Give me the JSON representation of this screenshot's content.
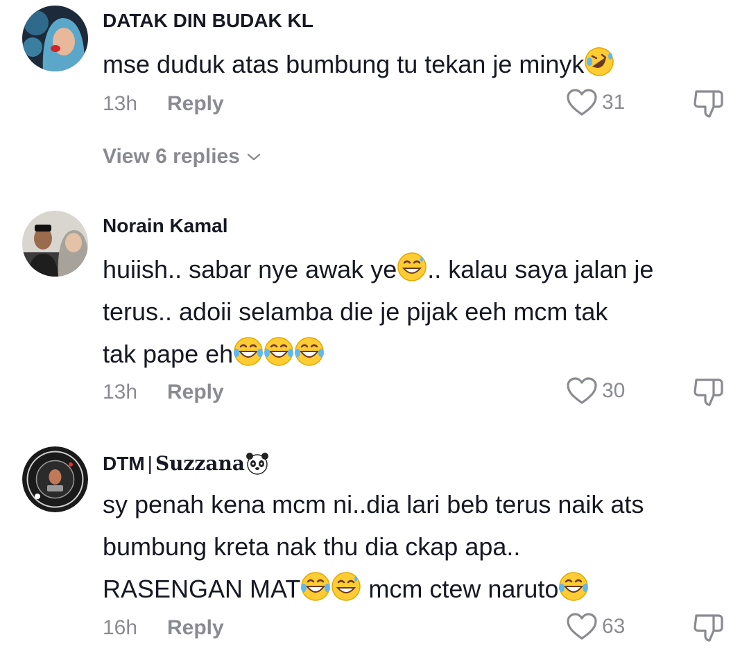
{
  "comments": [
    {
      "username": "DATAK DIN BUDAK KL",
      "lines": [
        {
          "text": "mse duduk atas bumbung tu tekan je minyk",
          "emojis": [
            "rofl"
          ]
        }
      ],
      "time": "13h",
      "reply_label": "Reply",
      "likes": "31",
      "view_replies": "View 6 replies"
    },
    {
      "username": "Norain Kamal",
      "lines": [
        {
          "text": "huiish.. sabar nye awak ye",
          "emojis": [
            "sweat-smile"
          ],
          "after": ".. kalau saya jalan je"
        },
        {
          "text": "terus.. adoii selamba die je pijak eeh mcm tak",
          "emojis": []
        },
        {
          "text": "tak pape eh",
          "emojis": [
            "tears-of-joy",
            "tears-of-joy",
            "tears-of-joy"
          ]
        }
      ],
      "time": "13h",
      "reply_label": "Reply",
      "likes": "30"
    },
    {
      "username_prefix": "DTM",
      "username_separator": "|",
      "username_styled": "Suzzana",
      "username_icon": "panda-icon",
      "lines": [
        {
          "text": "sy penah kena mcm ni..dia lari beb terus naik ats",
          "emojis": []
        },
        {
          "text": "bumbung kreta nak thu dia ckap apa..",
          "emojis": []
        },
        {
          "text": "RASENGAN MAT",
          "emojis": [
            "tears-of-joy",
            "sweat-smile"
          ],
          "after": " mcm ctew naruto",
          "after_emojis": [
            "tears-of-joy"
          ]
        }
      ],
      "time": "16h",
      "reply_label": "Reply",
      "likes": "63"
    }
  ],
  "colors": {
    "text": "#161823",
    "muted": "#8a8b91",
    "emoji": "#ffcc33"
  }
}
